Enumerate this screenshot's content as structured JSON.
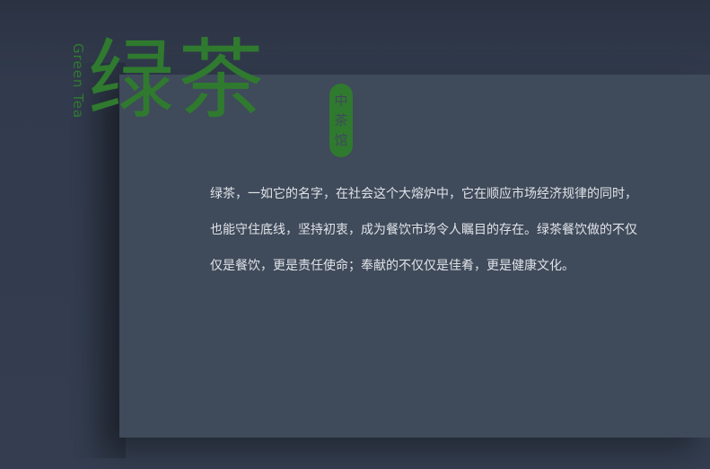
{
  "header": {
    "title_cn": "绿茶",
    "title_en": "Green Tea",
    "seal_chars": [
      "中",
      "茶",
      "馆"
    ]
  },
  "main": {
    "paragraph_lines": [
      "绿茶，一如它的名字，在社会这个大熔炉中，它在顺应市场经济规律的同时，",
      "也能守住底线，坚持初衷，成为餐饮市场令人瞩目的存在。绿茶餐饮做的不仅",
      "仅是餐饮，更是责任使命；奉献的不仅仅是佳肴，更是健康文化。"
    ]
  },
  "colors": {
    "background": "#323b4c",
    "panel": "#3f4a5a",
    "accent_green": "#2f7a2f",
    "text": "#e0e3e8"
  }
}
